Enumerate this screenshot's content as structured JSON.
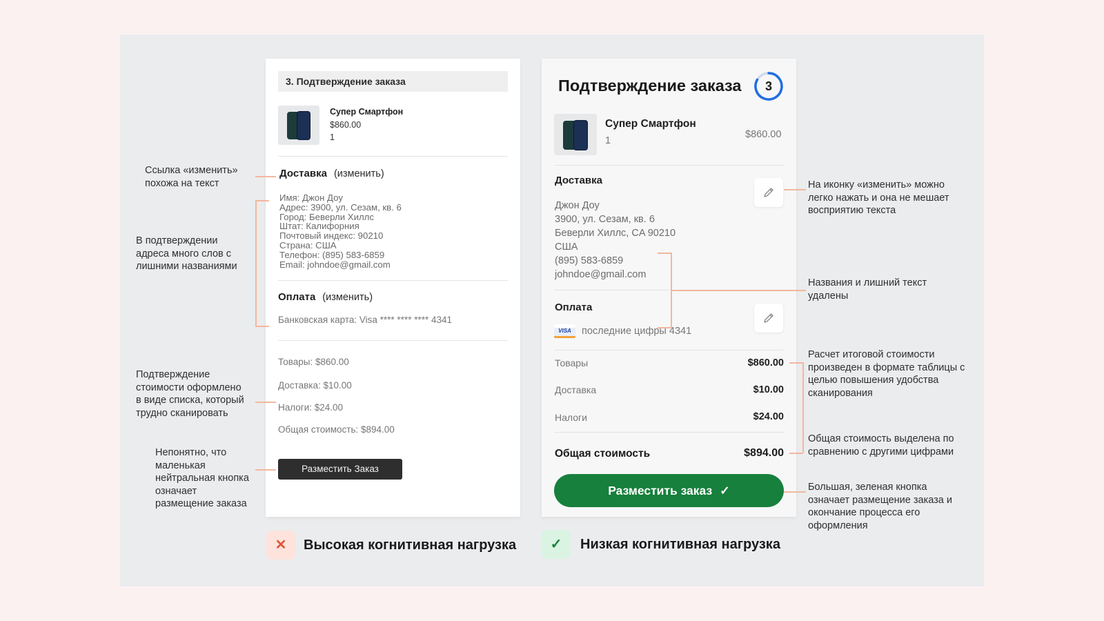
{
  "bad": {
    "header": "3. Подтверждение заказа",
    "product": {
      "name": "Супер Смартфон",
      "price": "$860.00",
      "qty": "1"
    },
    "delivery": {
      "title": "Доставка",
      "edit": "(изменить)"
    },
    "address_lines": [
      "Имя: Джон Доу",
      "Адрес: 3900, ул. Сезам, кв. 6",
      "Город: Беверли Хиллс",
      "Штат: Калифорния",
      "Почтовый индекс: 90210",
      "Страна: США",
      "Телефон: (895) 583-6859",
      "Email: johndoe@gmail.com"
    ],
    "payment": {
      "title": "Оплата",
      "edit": "(изменить)",
      "card": "Банковская карта: Visa **** **** **** 4341"
    },
    "totals": {
      "items": "Товары: $860.00",
      "delivery": "Доставка: $10.00",
      "taxes": "Налоги: $24.00",
      "total": "Общая стоимость: $894.00"
    },
    "button": "Разместить Заказ",
    "badge_icon": "✕",
    "badge_label": "Высокая когнитивная нагрузка"
  },
  "good": {
    "title": "Подтверждение заказа",
    "step": "3",
    "product": {
      "name": "Супер Смартфон",
      "qty": "1",
      "price": "$860.00"
    },
    "delivery": {
      "title": "Доставка"
    },
    "address_lines": [
      "Джон Доу",
      "3900, ул. Сезам, кв. 6",
      "Беверли Хиллс, CA 90210",
      "США",
      "(895) 583-6859",
      "johndoe@gmail.com"
    ],
    "payment": {
      "title": "Оплата",
      "card_brand": "VISA",
      "card": "последние цифры 4341"
    },
    "rows": {
      "items_label": "Товары",
      "items_value": "$860.00",
      "delivery_label": "Доставка",
      "delivery_value": "$10.00",
      "taxes_label": "Налоги",
      "taxes_value": "$24.00",
      "total_label": "Общая стоимость",
      "total_value": "$894.00"
    },
    "button": "Разместить заказ",
    "button_icon": "✓",
    "badge_icon": "✓",
    "badge_label": "Низкая когнитивная нагрузка"
  },
  "notes_left": {
    "edit_link": "Ссылка «изменить» похожа на текст",
    "address": "В подтверждении адреса много слов с лишними названиями",
    "cost": "Подтверждение стоимости оформлено в виде списка, который трудно сканировать",
    "button": "Непонятно, что маленькая нейтральная кнопка означает размещение заказа"
  },
  "notes_right": {
    "edit_icon": "На иконку «изменить» можно легко нажать и она не мешает восприятию текста",
    "removed": "Названия и лишний текст удалены",
    "table": "Расчет итоговой стоимости произведен в формате таблицы с целью повышения удобства сканирования",
    "total": "Общая стоимость выделена по сравнению с другими цифрами",
    "button": "Большая, зеленая кнопка означает размещение заказа и окончание процесса его оформления"
  },
  "colors": {
    "accent_green": "#16803c",
    "step_blue": "#1f6fe0",
    "annotation_line": "#f2b79e",
    "bad_badge": "#e0553a",
    "good_badge": "#16803c"
  },
  "icons": {
    "edit": "pencil-icon",
    "check": "check-icon",
    "cross": "cross-icon",
    "visa": "visa-card-icon",
    "phone": "smartphone-image"
  }
}
